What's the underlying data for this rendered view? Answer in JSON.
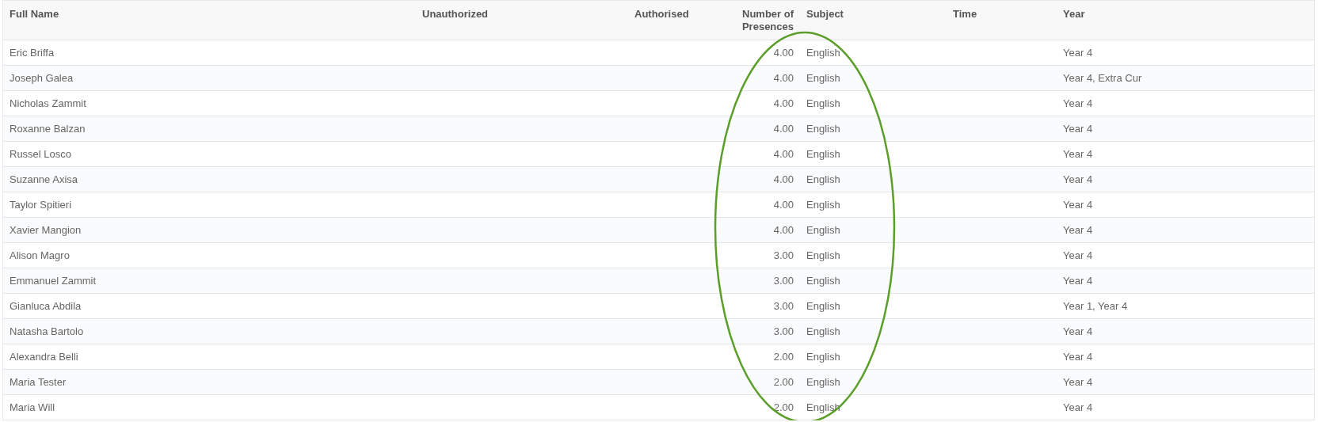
{
  "table": {
    "columns": [
      "Full Name",
      "Unauthorized",
      "Authorised",
      "Number of Presences",
      "Subject",
      "Time",
      "Year"
    ],
    "rows": [
      {
        "full_name": "Eric Briffa",
        "presences": "4.00",
        "subject": "English",
        "year": "Year 4"
      },
      {
        "full_name": "Joseph Galea",
        "presences": "4.00",
        "subject": "English",
        "year": "Year 4, Extra Cur"
      },
      {
        "full_name": "Nicholas Zammit",
        "presences": "4.00",
        "subject": "English",
        "year": "Year 4"
      },
      {
        "full_name": "Roxanne Balzan",
        "presences": "4.00",
        "subject": "English",
        "year": "Year 4"
      },
      {
        "full_name": "Russel Losco",
        "presences": "4.00",
        "subject": "English",
        "year": "Year 4"
      },
      {
        "full_name": "Suzanne Axisa",
        "presences": "4.00",
        "subject": "English",
        "year": "Year 4"
      },
      {
        "full_name": "Taylor Spitieri",
        "presences": "4.00",
        "subject": "English",
        "year": "Year 4"
      },
      {
        "full_name": "Xavier Mangion",
        "presences": "4.00",
        "subject": "English",
        "year": "Year 4"
      },
      {
        "full_name": "Alison Magro",
        "presences": "3.00",
        "subject": "English",
        "year": "Year 4"
      },
      {
        "full_name": "Emmanuel Zammit",
        "presences": "3.00",
        "subject": "English",
        "year": "Year 4"
      },
      {
        "full_name": "Gianluca Abdila",
        "presences": "3.00",
        "subject": "English",
        "year": "Year 1, Year 4"
      },
      {
        "full_name": "Natasha Bartolo",
        "presences": "3.00",
        "subject": "English",
        "year": "Year 4"
      },
      {
        "full_name": "Alexandra Belli",
        "presences": "2.00",
        "subject": "English",
        "year": "Year 4"
      },
      {
        "full_name": "Maria Tester",
        "presences": "2.00",
        "subject": "English",
        "year": "Year 4"
      },
      {
        "full_name": "Maria Will",
        "presences": "2.00",
        "subject": "English",
        "year": "Year 4"
      }
    ]
  }
}
